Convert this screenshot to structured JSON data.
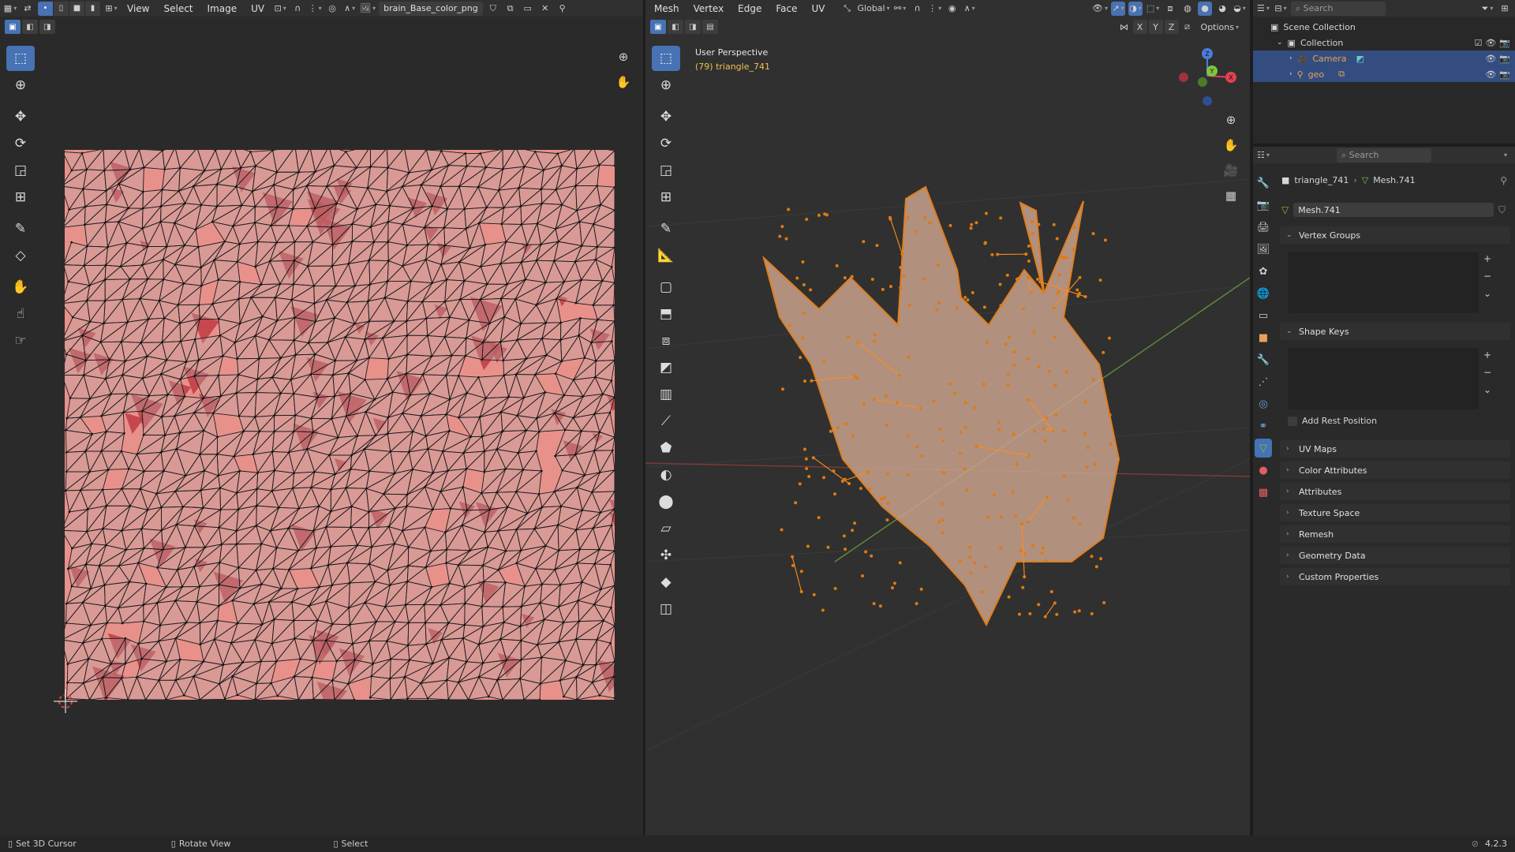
{
  "uv_editor": {
    "menus": [
      "View",
      "Select",
      "Image",
      "UV"
    ],
    "image_name": "brain_Base_color_png"
  },
  "viewport": {
    "menus": [
      "Mesh",
      "Vertex",
      "Edge",
      "Face",
      "UV"
    ],
    "orientation": "Global",
    "axes": [
      "X",
      "Y",
      "Z"
    ],
    "options_label": "Options",
    "perspective_label": "User Perspective",
    "object_label": "(79) triangle_741",
    "gizmo": {
      "x": "X",
      "y": "Y",
      "z": "Z"
    }
  },
  "outliner": {
    "search_placeholder": "Search",
    "scene_collection": "Scene Collection",
    "collection": "Collection",
    "items": [
      {
        "label": "Camera"
      },
      {
        "label": "geo"
      }
    ]
  },
  "properties": {
    "search_placeholder": "Search",
    "breadcrumb_object": "triangle_741",
    "breadcrumb_mesh": "Mesh.741",
    "mesh_name": "Mesh.741",
    "panels": {
      "vertex_groups": "Vertex Groups",
      "shape_keys": "Shape Keys",
      "add_rest_position": "Add Rest Position",
      "uv_maps": "UV Maps",
      "color_attributes": "Color Attributes",
      "attributes": "Attributes",
      "texture_space": "Texture Space",
      "remesh": "Remesh",
      "geometry_data": "Geometry Data",
      "custom_properties": "Custom Properties"
    }
  },
  "statusbar": {
    "set_cursor": "Set 3D Cursor",
    "rotate_view": "Rotate View",
    "select": "Select",
    "version": "4.2.3"
  },
  "colors": {
    "accent": "#4772b3",
    "selection_orange": "#ff8c1a",
    "uv_texture": "#e8918a",
    "uv_dark": "#b9303a",
    "active_text": "#f0c24f"
  }
}
